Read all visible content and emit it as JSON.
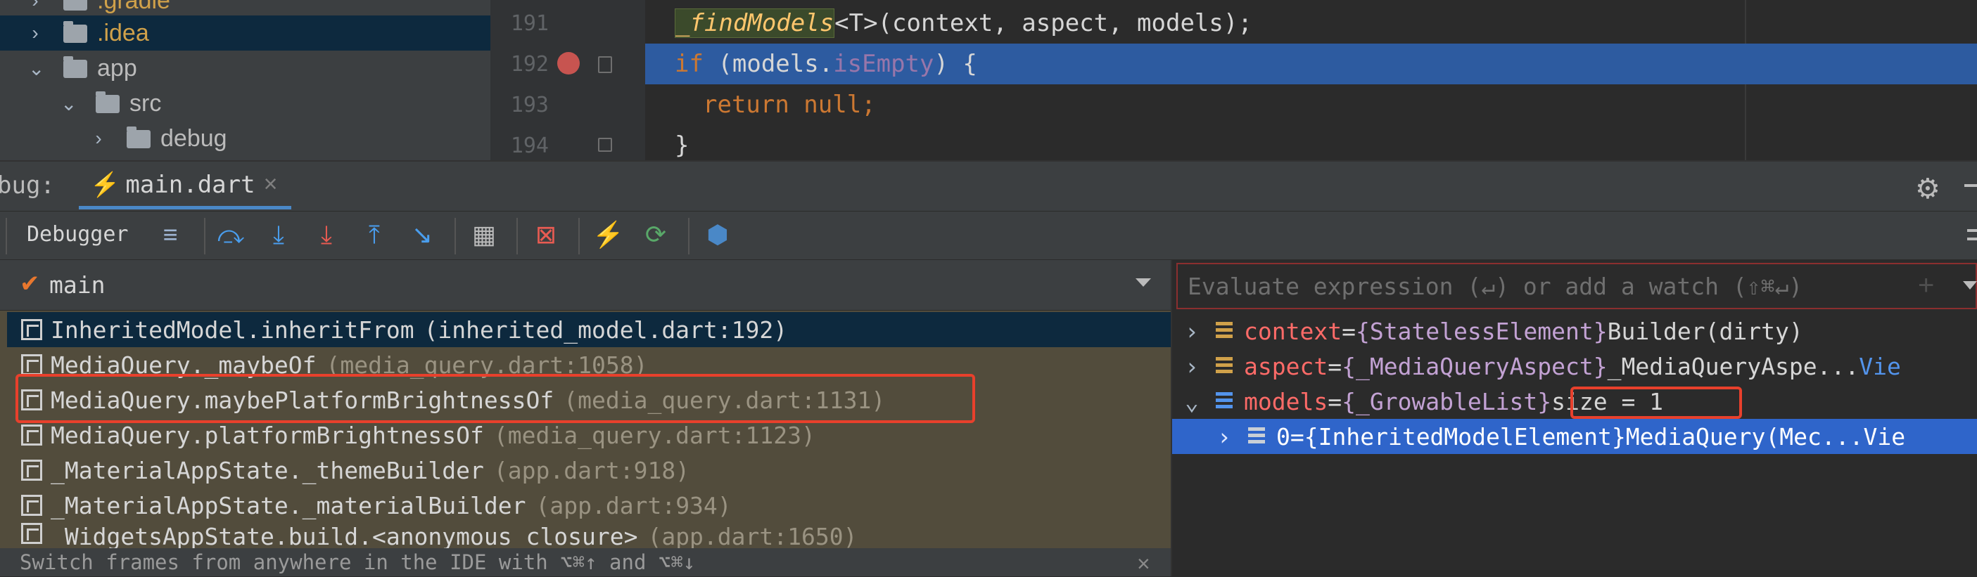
{
  "tree": {
    "items": [
      {
        "label": ".gradle",
        "chevron": "›"
      },
      {
        "label": ".idea",
        "chevron": "›"
      },
      {
        "label": "app",
        "chevron": "⌄"
      },
      {
        "label": "src",
        "chevron": "⌄"
      },
      {
        "label": "debug",
        "chevron": "›"
      }
    ]
  },
  "editor": {
    "line_numbers": [
      "191",
      "192",
      "193",
      "194"
    ],
    "line191": {
      "fn": "_findModels",
      "rest": "<T>(context, aspect, models);"
    },
    "line192": {
      "kw": "if",
      "open": " (models.",
      "prop": "isEmpty",
      "close": ") {"
    },
    "line193": {
      "kw": "return",
      "val": " null",
      "semi": ";"
    },
    "line194": {
      "text": "}"
    }
  },
  "debug": {
    "title": "bug:",
    "tab_label": "main.dart",
    "tab_close": "×",
    "toolbar_label": "Debugger",
    "thread": "main"
  },
  "frames": [
    {
      "method": "InheritedModel.inheritFrom",
      "loc": "(inherited_model.dart:192)"
    },
    {
      "method": "MediaQuery._maybeOf",
      "loc": "(media_query.dart:1058)"
    },
    {
      "method": "MediaQuery.maybePlatformBrightnessOf",
      "loc": "(media_query.dart:1131)"
    },
    {
      "method": "MediaQuery.platformBrightnessOf",
      "loc": "(media_query.dart:1123)"
    },
    {
      "method": "_MaterialAppState._themeBuilder",
      "loc": "(app.dart:918)"
    },
    {
      "method": "_MaterialAppState._materialBuilder",
      "loc": "(app.dart:934)"
    },
    {
      "method": "_WidgetsAppState.build.<anonymous closure>",
      "loc": "(app.dart:1650)"
    }
  ],
  "tip": "Switch frames from anywhere in the IDE with ⌥⌘↑ and ⌥⌘↓",
  "evaluate": {
    "placeholder": "Evaluate expression (↵) or add a watch (⇧⌘↵)"
  },
  "variables": [
    {
      "name": "context",
      "eq": " = ",
      "type": "{StatelessElement}",
      "value": " Builder(dirty)"
    },
    {
      "name": "aspect",
      "eq": " = ",
      "type": "{_MediaQueryAspect}",
      "value": " _MediaQueryAspe...",
      "link": " Vie"
    },
    {
      "name": "models",
      "eq": " = ",
      "type": "{_GrowableList}",
      "value": " size = 1"
    },
    {
      "name": "0",
      "eq": " = ",
      "type": "{InheritedModelElement}",
      "value": " MediaQuery(Mec...",
      "link": " Vie"
    }
  ],
  "colors": {
    "accent": "#2f65ca",
    "breakpoint": "#c75450",
    "highlight_box": "#e8402c"
  }
}
